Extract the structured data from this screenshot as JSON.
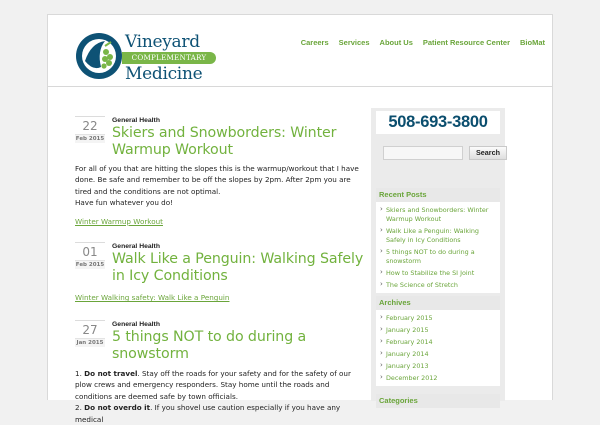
{
  "site": {
    "logo_top": "Vineyard",
    "logo_band": "COMPLEMENTARY",
    "logo_bottom": "Medicine",
    "accent_green": "#72b23e",
    "brand_blue": "#0e5275"
  },
  "nav": {
    "items": [
      "Careers",
      "Services",
      "About Us",
      "Patient Resource Center",
      "BioMat"
    ]
  },
  "posts": [
    {
      "day": "22",
      "month": "Feb 2015",
      "category": "General Health",
      "title": "Skiers and Snowborders: Winter Warmup Workout",
      "body": "For all of you that are hitting the slopes this is the warmup/workout that I have done. Be safe and remember to be off the slopes by 2pm. After 2pm you are tired and the conditions are not optimal.",
      "body2": "Have fun whatever you do!",
      "link": "Winter Warmup Workout"
    },
    {
      "day": "01",
      "month": "Feb 2015",
      "category": "General Health",
      "title": "Walk Like a Penguin: Walking Safely in Icy Conditions",
      "link": "Winter Walking safety: Walk Like a Penguin"
    },
    {
      "day": "27",
      "month": "Jan 2015",
      "category": "General Health",
      "title": "5 things NOT to do during a snowstorm",
      "item1_bold": "Do not travel",
      "item1_text": ". Stay off the roads for your safety and for the safety of our plow crews and emergency responders. Stay home until the roads and conditions are deemed safe by town officials.",
      "item2_bold": "Do not overdo it",
      "item2_text": ". If you shovel use caution especially if you have any medical"
    }
  ],
  "sidebar": {
    "phone": "508-693-3800",
    "search_button": "Search",
    "search_placeholder": "",
    "recent_title": "Recent Posts",
    "recent": [
      "Skiers and Snowborders: Winter Warmup Workout",
      "Walk Like a Penguin: Walking Safely in Icy Conditions",
      "5 things NOT to do during a snowstorm",
      "How to Stabilize the SI Joint",
      "The Science of Stretch"
    ],
    "archives_title": "Archives",
    "archives": [
      "February 2015",
      "January 2015",
      "February 2014",
      "January 2014",
      "January 2013",
      "December 2012"
    ],
    "categories_title": "Categories"
  }
}
